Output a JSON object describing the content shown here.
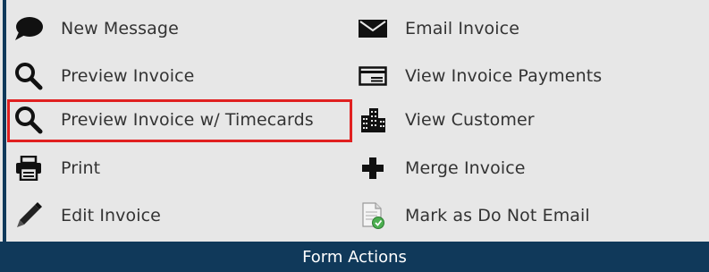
{
  "panel": {
    "title": "Form Actions",
    "left": [
      {
        "label": "New Message",
        "icon": "speech-bubble-icon"
      },
      {
        "label": "Preview Invoice",
        "icon": "magnifier-icon"
      },
      {
        "label": "Preview Invoice w/ Timecards",
        "icon": "magnifier-icon",
        "highlighted": true
      },
      {
        "label": "Print",
        "icon": "printer-icon"
      },
      {
        "label": "Edit Invoice",
        "icon": "pencil-icon"
      }
    ],
    "right": [
      {
        "label": "Email Invoice",
        "icon": "envelope-icon"
      },
      {
        "label": "View Invoice Payments",
        "icon": "payment-card-icon"
      },
      {
        "label": "View Customer",
        "icon": "buildings-icon"
      },
      {
        "label": "Merge Invoice",
        "icon": "plus-icon"
      },
      {
        "label": "Mark as Do Not Email",
        "icon": "document-green-check-icon"
      }
    ]
  },
  "colors": {
    "background": "#e7e7e7",
    "footer": "#10395a",
    "highlight_border": "#e02020",
    "icon": "#111111"
  }
}
